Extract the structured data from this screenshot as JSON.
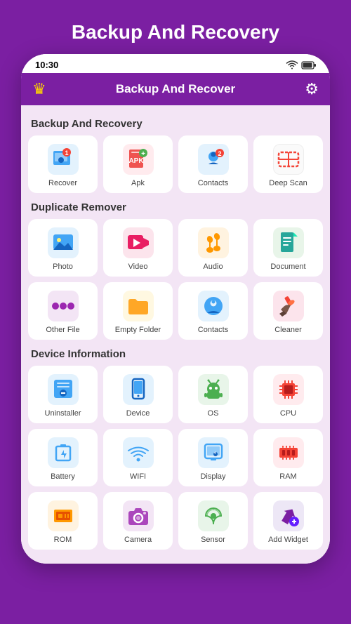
{
  "page": {
    "title": "Backup And Recovery",
    "status_bar": {
      "time": "10:30"
    },
    "header": {
      "title": "Backup And Recover"
    },
    "sections": [
      {
        "id": "backup",
        "title": "Backup And Recovery",
        "items": [
          {
            "id": "recover",
            "label": "Recover"
          },
          {
            "id": "apk",
            "label": "Apk"
          },
          {
            "id": "contacts",
            "label": "Contacts"
          },
          {
            "id": "deepscan",
            "label": "Deep Scan"
          }
        ]
      },
      {
        "id": "duplicate",
        "title": "Duplicate Remover",
        "items": [
          {
            "id": "photo",
            "label": "Photo"
          },
          {
            "id": "video",
            "label": "Video"
          },
          {
            "id": "audio",
            "label": "Audio"
          },
          {
            "id": "document",
            "label": "Document"
          },
          {
            "id": "otherfile",
            "label": "Other File"
          },
          {
            "id": "emptyfolder",
            "label": "Empty Folder"
          },
          {
            "id": "contacts2",
            "label": "Contacts"
          },
          {
            "id": "cleaner",
            "label": "Cleaner"
          }
        ]
      },
      {
        "id": "device",
        "title": "Device Information",
        "items": [
          {
            "id": "uninstaller",
            "label": "Uninstaller"
          },
          {
            "id": "device",
            "label": "Device"
          },
          {
            "id": "os",
            "label": "OS"
          },
          {
            "id": "cpu",
            "label": "CPU"
          },
          {
            "id": "battery",
            "label": "Battery"
          },
          {
            "id": "wifi",
            "label": "WIFI"
          },
          {
            "id": "display",
            "label": "Display"
          },
          {
            "id": "ram",
            "label": "RAM"
          },
          {
            "id": "rom",
            "label": "ROM"
          },
          {
            "id": "camera",
            "label": "Camera"
          },
          {
            "id": "sensor",
            "label": "Sensor"
          },
          {
            "id": "addwidget",
            "label": "Add Widget"
          }
        ]
      }
    ]
  }
}
